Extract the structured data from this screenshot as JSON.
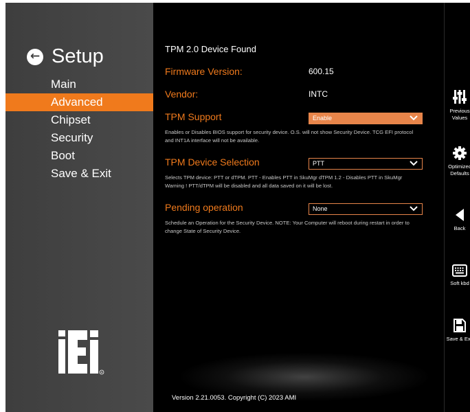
{
  "sidebar": {
    "title": "Setup",
    "items": [
      {
        "label": "Main"
      },
      {
        "label": "Advanced"
      },
      {
        "label": "Chipset"
      },
      {
        "label": "Security"
      },
      {
        "label": "Boot"
      },
      {
        "label": "Save & Exit"
      }
    ],
    "active_index": 1,
    "logo_text": "iEi"
  },
  "main": {
    "header": "TPM 2.0 Device Found",
    "firmware_label": "Firmware Version:",
    "firmware_value": "600.15",
    "vendor_label": "Vendor:",
    "vendor_value": "INTC",
    "tpm_support": {
      "label": "TPM Support",
      "value": "Enable",
      "description": "Enables or Disables BIOS support for security device. O.S. will not show Security Device. TCG EFI protocol and INT1A interface will not be available."
    },
    "device_selection": {
      "label": "TPM Device Selection",
      "value": "PTT",
      "description": "Selects TPM device: PTT or dTPM. PTT - Enables PTT in SkuMgr dTPM 1.2 - Disables PTT in SkuMgr Warning ! PTT/dTPM will be disabled and all data saved on it will be lost."
    },
    "pending_operation": {
      "label": "Pending operation",
      "value": "None",
      "description": "Schedule an Operation for the Security Device. NOTE: Your Computer will reboot during restart in order to change State of Security Device."
    },
    "footer": "Version 2.21.0053. Copyright (C) 2023 AMI"
  },
  "toolbar": {
    "items": [
      {
        "label": "Previous\nValues",
        "icon": "sliders-icon"
      },
      {
        "label": "Optimized\nDefaults",
        "icon": "gear-icon"
      },
      {
        "label": "Back",
        "icon": "back-arrow-icon"
      },
      {
        "label": "Soft kbd",
        "icon": "keyboard-icon"
      },
      {
        "label": "Save & Exit",
        "icon": "floppy-disk-icon"
      }
    ]
  },
  "colors": {
    "accent": "#f07a1c",
    "sidebar_bg": "#454545",
    "dropdown_border": "#e8854a",
    "background": "#000000"
  }
}
